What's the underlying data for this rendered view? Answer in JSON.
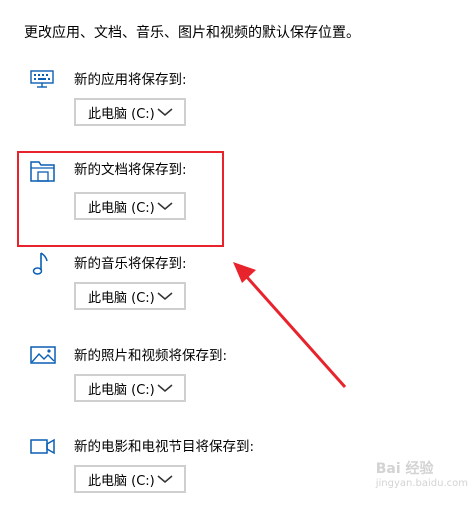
{
  "intro": "更改应用、文档、音乐、图片和视频的默认保存位置。",
  "settings": [
    {
      "label": "新的应用将保存到:",
      "value": "此电脑 (C:)",
      "icon": "monitor-keyboard-icon"
    },
    {
      "label": "新的文档将保存到:",
      "value": "此电脑 (C:)",
      "icon": "folder-document-icon"
    },
    {
      "label": "新的音乐将保存到:",
      "value": "此电脑 (C:)",
      "icon": "music-note-icon"
    },
    {
      "label": "新的照片和视频将保存到:",
      "value": "此电脑 (C:)",
      "icon": "picture-icon"
    },
    {
      "label": "新的电影和电视节目将保存到:",
      "value": "此电脑 (C:)",
      "icon": "video-camera-icon"
    }
  ],
  "watermark": {
    "text": "Bai  经验",
    "sub": "jingyan.baidu.com"
  },
  "colors": {
    "accent": "#0a5fb4",
    "annotation": "#e8232b",
    "dropdown_border": "#cfcfcf"
  }
}
